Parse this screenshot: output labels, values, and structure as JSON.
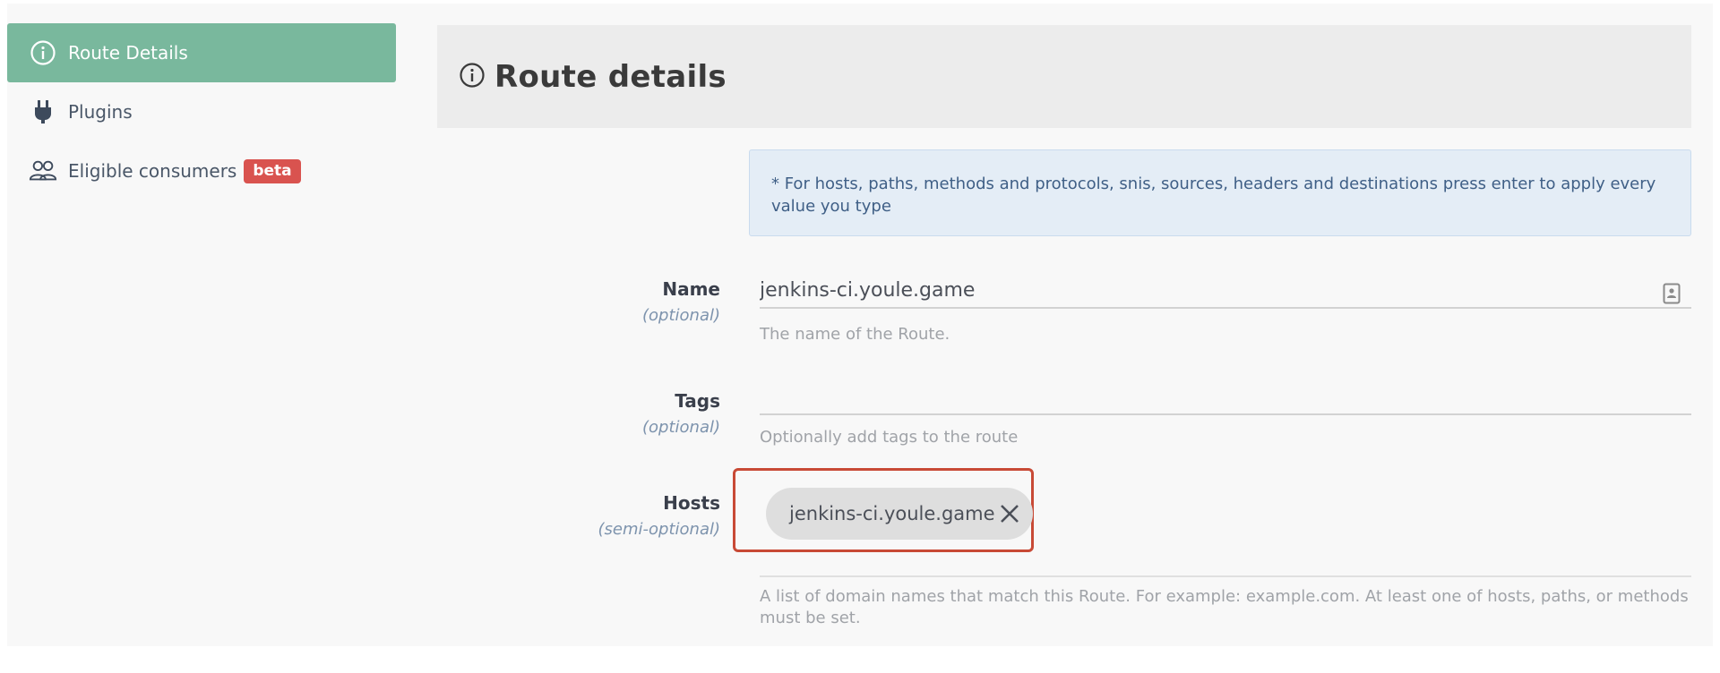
{
  "sidebar": {
    "items": [
      {
        "label": "Route Details",
        "icon": "info-icon",
        "active": true
      },
      {
        "label": "Plugins",
        "icon": "plug-icon",
        "active": false
      },
      {
        "label": "Eligible consumers",
        "icon": "users-icon",
        "active": false,
        "badge": "beta"
      }
    ]
  },
  "header": {
    "title": "Route details",
    "icon": "info-icon"
  },
  "notice": {
    "text": "* For hosts, paths, methods and protocols, snis, sources, headers and destinations press enter to apply every value you type"
  },
  "form": {
    "name": {
      "label": "Name",
      "hint": "(optional)",
      "value": "jenkins-ci.youle.game",
      "help": "The name of the Route."
    },
    "tags": {
      "label": "Tags",
      "hint": "(optional)",
      "value": "",
      "help": "Optionally add tags to the route"
    },
    "hosts": {
      "label": "Hosts",
      "hint": "(semi-optional)",
      "chips": [
        "jenkins-ci.youle.game"
      ],
      "help": "A list of domain names that match this Route. For example: example.com. At least one of hosts, paths, or methods must be set."
    }
  },
  "colors": {
    "active_sidebar": "#79b89d",
    "badge": "#d9534f",
    "highlight_border": "#c84a36",
    "notice_bg": "#e4edf6"
  }
}
